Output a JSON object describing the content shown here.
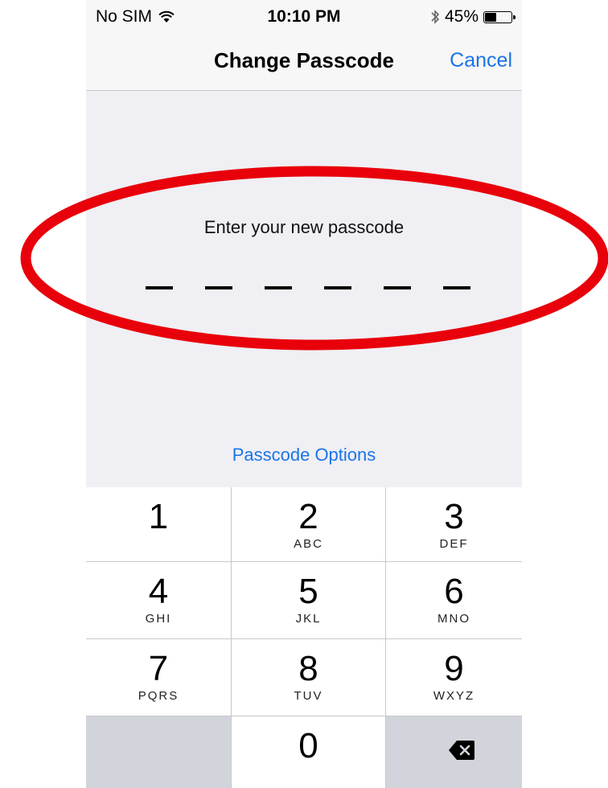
{
  "status_bar": {
    "carrier": "No SIM",
    "time": "10:10 PM",
    "battery_percent": "45%",
    "battery_level": 0.45,
    "wifi_icon": "wifi-icon",
    "bluetooth_icon": "bluetooth-icon"
  },
  "nav": {
    "title": "Change Passcode",
    "cancel_label": "Cancel"
  },
  "passcode": {
    "prompt": "Enter your new passcode",
    "digits_total": 6,
    "digits_entered": 0
  },
  "options_label": "Passcode Options",
  "keypad": {
    "keys": [
      {
        "digit": "1",
        "letters": ""
      },
      {
        "digit": "2",
        "letters": "ABC"
      },
      {
        "digit": "3",
        "letters": "DEF"
      },
      {
        "digit": "4",
        "letters": "GHI"
      },
      {
        "digit": "5",
        "letters": "JKL"
      },
      {
        "digit": "6",
        "letters": "MNO"
      },
      {
        "digit": "7",
        "letters": "PQRS"
      },
      {
        "digit": "8",
        "letters": "TUV"
      },
      {
        "digit": "9",
        "letters": "WXYZ"
      },
      {
        "digit": "0",
        "letters": ""
      }
    ],
    "delete_icon": "backspace-icon"
  },
  "colors": {
    "accent": "#1a74e8",
    "annotation": "#e8000b",
    "background": "#efeff4"
  }
}
